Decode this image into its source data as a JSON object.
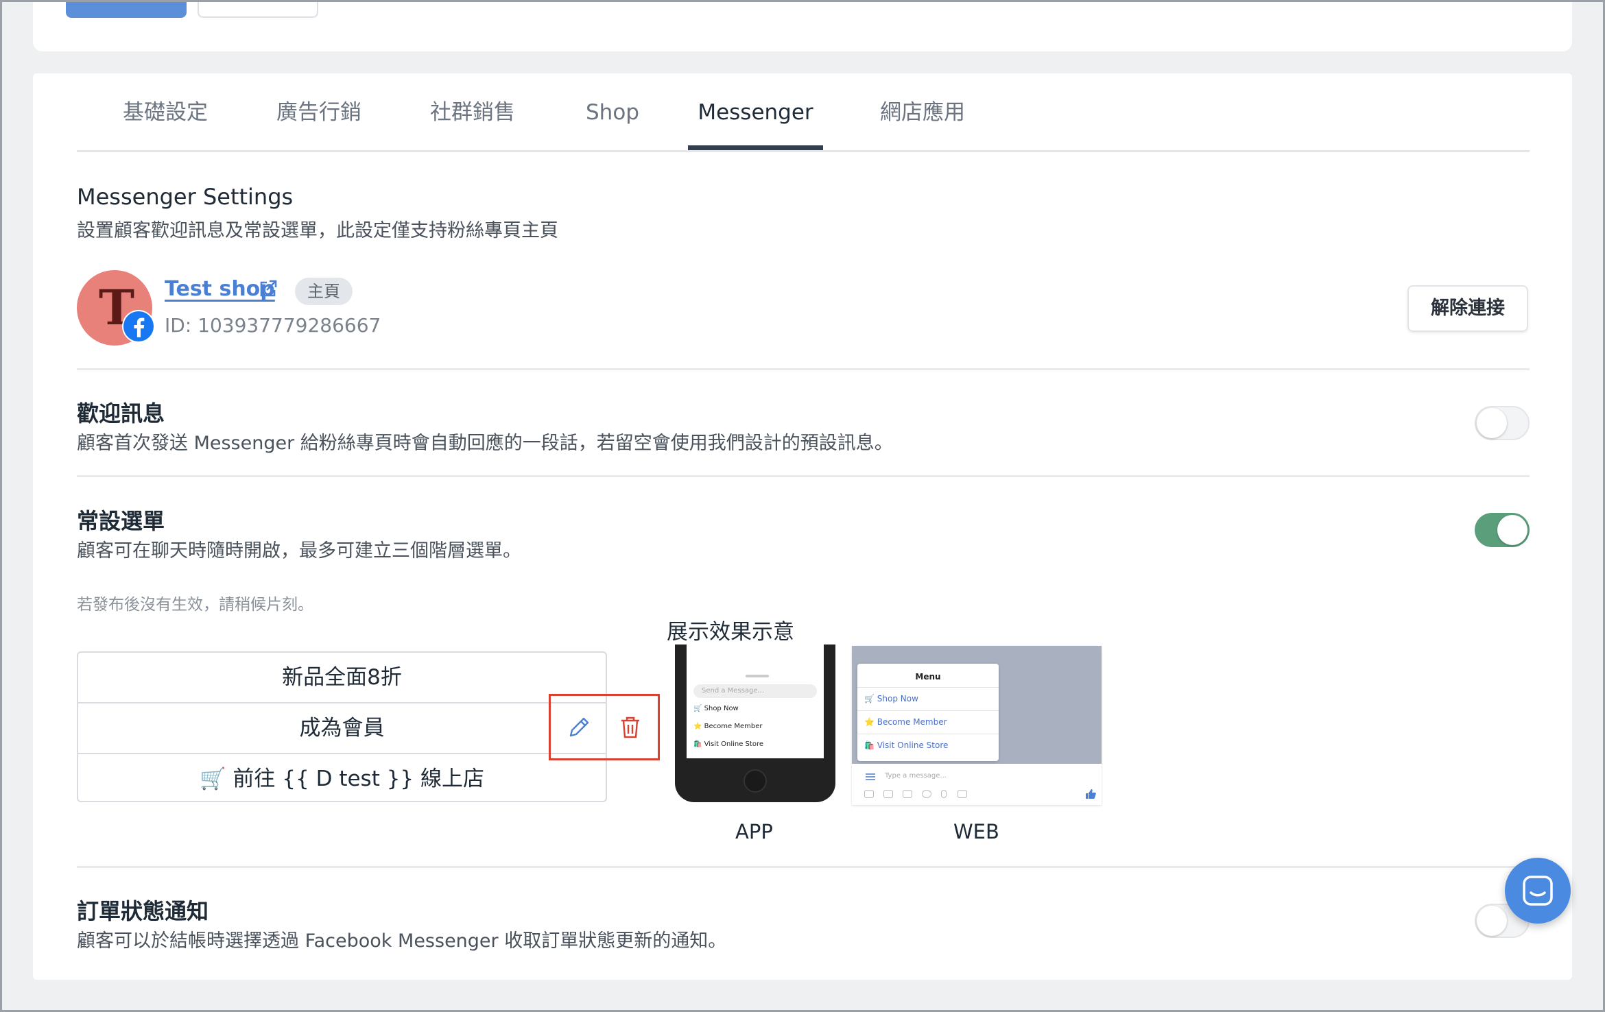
{
  "tabs": [
    {
      "label": "基礎設定"
    },
    {
      "label": "廣告行銷"
    },
    {
      "label": "社群銷售"
    },
    {
      "label": "Shop"
    },
    {
      "label": "Messenger"
    },
    {
      "label": "網店應用"
    }
  ],
  "active_tab": "Messenger",
  "settings": {
    "title": "Messenger Settings",
    "subtitle": "設置顧客歡迎訊息及常設選單，此設定僅支持粉絲專頁主頁"
  },
  "page": {
    "avatar_letter": "T",
    "name": "Test shop",
    "tag": "主頁",
    "id_text": "ID: 103937779286667",
    "disconnect_label": "解除連接"
  },
  "welcome": {
    "title": "歡迎訊息",
    "desc": "顧客首次發送 Messenger 給粉絲專頁時會自動回應的一段話，若留空會使用我們設計的預設訊息。",
    "enabled": false
  },
  "persistent_menu": {
    "title": "常設選單",
    "desc": "顧客可在聊天時隨時開啟，最多可建立三個階層選單。",
    "enabled": true,
    "note": "若發布後沒有生效，請稍候片刻。",
    "items": [
      {
        "label": "新品全面8折"
      },
      {
        "label": "成為會員"
      },
      {
        "label": "🛒 前往 {{ D test }} 線上店"
      }
    ]
  },
  "preview": {
    "title": "展示效果示意",
    "app_caption": "APP",
    "web_caption": "WEB",
    "app": {
      "input_placeholder": "Send a Message...",
      "items": [
        "🛒 Shop Now",
        "⭐ Become Member",
        "🛍️ Visit Online Store"
      ]
    },
    "web": {
      "menu_title": "Menu",
      "items": [
        "🛒 Shop Now",
        "⭐ Become Member",
        "🛍️ Visit Online Store"
      ],
      "input_placeholder": "Type a message..."
    }
  },
  "order_notify": {
    "title": "訂單狀態通知",
    "desc": "顧客可以於結帳時選擇透過 Facebook Messenger 收取訂單狀態更新的通知。",
    "enabled": false
  },
  "colors": {
    "accent": "#4a7fd3",
    "toggle_on": "#5b9e7b",
    "highlight": "#d8412f"
  }
}
